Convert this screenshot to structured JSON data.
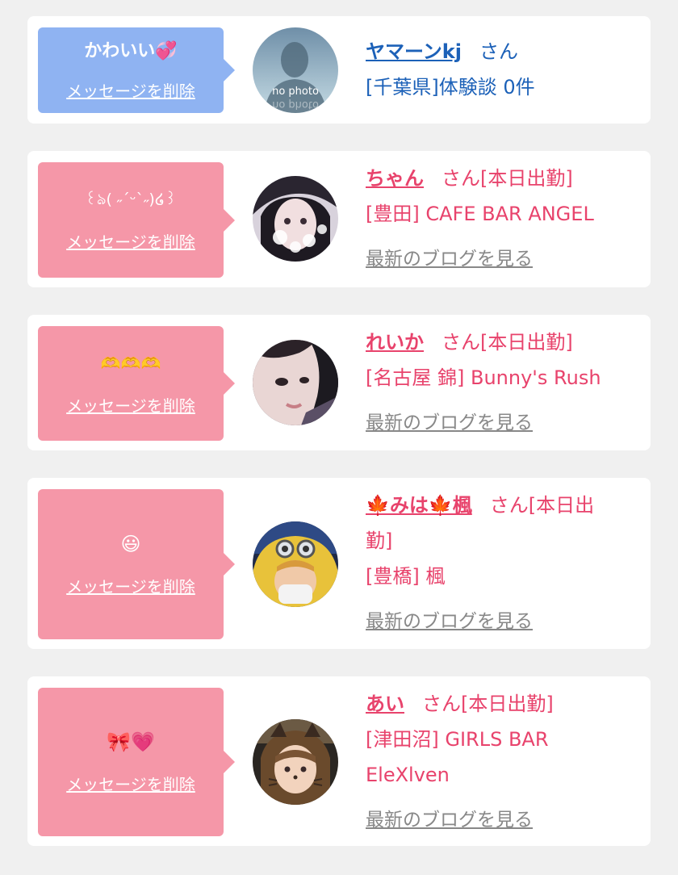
{
  "cards": [
    {
      "bubble_message": "かわいい💞",
      "delete_label": "メッセージを削除",
      "name": "ヤマーンkj",
      "san": "さん",
      "detail": "[千葉県]体験談 0件",
      "avatar_text": "no photo",
      "avatar_text_reflection": "no photo"
    },
    {
      "bubble_message": "꒰ঌ( ˶ˊᵕˋ˶)໒꒱",
      "delete_label": "メッセージを削除",
      "name": "ちゃん",
      "san_status": "さん[本日出勤]",
      "shop": "[豊田] CAFE BAR ANGEL",
      "blog_label": "最新のブログを見る"
    },
    {
      "bubble_message": "🫶🫶🫶",
      "delete_label": "メッセージを削除",
      "name": "れいか",
      "san_status": "さん[本日出勤]",
      "shop": "[名古屋 錦] Bunny's Rush",
      "blog_label": "最新のブログを見る"
    },
    {
      "bubble_message": "😃",
      "delete_label": "メッセージを削除",
      "name": "🍁みは🍁楓",
      "san_status_line1": "さん[本日出",
      "san_status_line2": "勤]",
      "shop": "[豊橋] 楓",
      "blog_label": "最新のブログを見る"
    },
    {
      "bubble_message": "🎀💗",
      "delete_label": "メッセージを削除",
      "name": "あい",
      "san_status": "さん[本日出勤]",
      "shop_line1": "[津田沼] GIRLS BAR",
      "shop_line2": "EleXlven",
      "blog_label": "最新のブログを見る"
    }
  ],
  "colors": {
    "background": "#f0f0f0",
    "bubble_blue": "#8fb3f2",
    "bubble_pink": "#f597a8",
    "link_blue": "#1c61b8",
    "text_pink": "#e8436c",
    "blog_gray": "#888888"
  }
}
